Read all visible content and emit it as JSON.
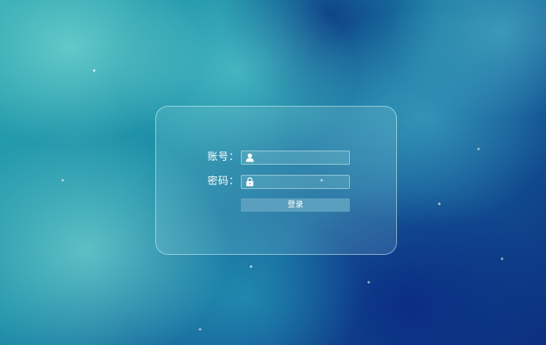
{
  "login_form": {
    "username": {
      "label": "账号：",
      "value": "",
      "placeholder": "",
      "icon": "user-icon"
    },
    "password": {
      "label": "密码：",
      "value": "",
      "placeholder": "",
      "icon": "lock-icon"
    },
    "submit_label": "登录"
  },
  "colors": {
    "button": "#5b9fbe",
    "panel_border": "#dcf5f5",
    "text": "#ffffff"
  }
}
